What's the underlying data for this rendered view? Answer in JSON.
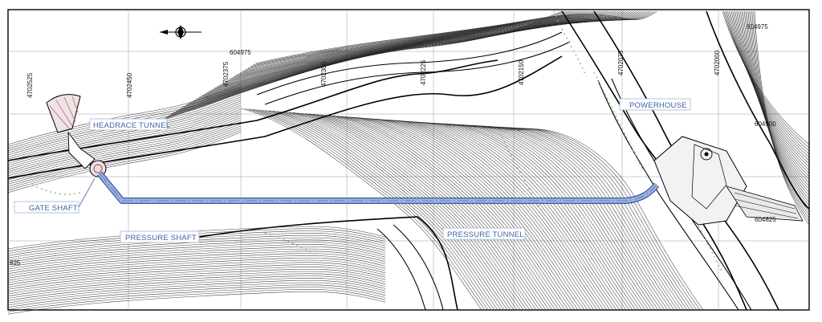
{
  "labels": {
    "headrace_tunnel": "HEADRACE TUNNEL",
    "gate_shaft": "GATE SHAFT",
    "pressure_shaft": "PRESSURE SHAFT",
    "pressure_tunnel": "PRESSURE TUNNEL",
    "powerhouse": "POWERHOUSE"
  },
  "coordinates": {
    "e_4702525": "4702525",
    "e_4702450": "4702450",
    "e_4702375": "4702375",
    "e_4702300": "4702300",
    "e_4702225": "4702225",
    "e_4702150": "4702150",
    "e_4702075": "4702075",
    "e_4702000": "4702000",
    "n_604975_left": "604975",
    "n_604975_right": "604975",
    "n_604900": "604900",
    "n_604825": "604825",
    "n_825_left": "825"
  },
  "icons": {
    "north_arrow": "north-arrow-icon"
  },
  "colors": {
    "tunnel_fill": "#9db1dc",
    "tunnel_stroke": "#3b5aa6",
    "label_text": "#3f63a7",
    "vegetation": "#76b27a",
    "contour": "#222222"
  }
}
